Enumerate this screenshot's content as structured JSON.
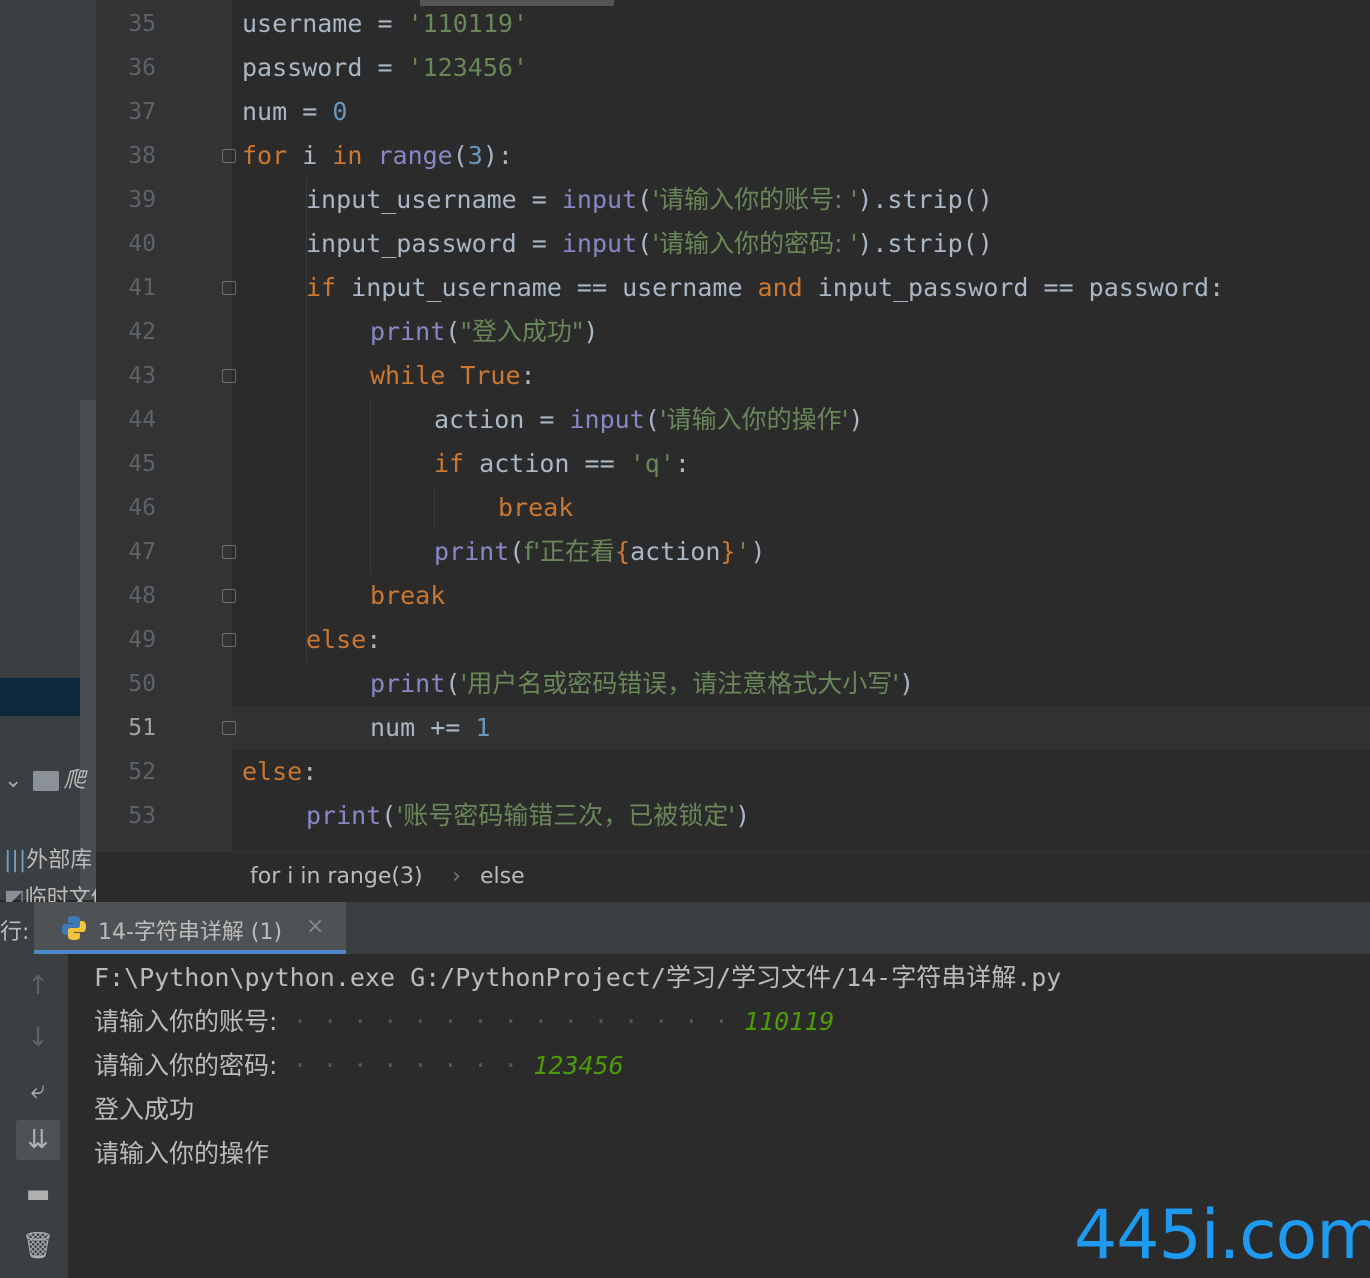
{
  "project_panel": {
    "items": [
      {
        "label": "爬",
        "icon": "folder-icon"
      },
      {
        "label": "外部库",
        "icon": "library-icon"
      },
      {
        "label": "临时文件",
        "icon": "scratch-icon"
      }
    ]
  },
  "editor": {
    "current_line": "51",
    "lines": [
      {
        "n": "35"
      },
      {
        "n": "36"
      },
      {
        "n": "37"
      },
      {
        "n": "38"
      },
      {
        "n": "39"
      },
      {
        "n": "40"
      },
      {
        "n": "41"
      },
      {
        "n": "42"
      },
      {
        "n": "43"
      },
      {
        "n": "44"
      },
      {
        "n": "45"
      },
      {
        "n": "46"
      },
      {
        "n": "47"
      },
      {
        "n": "48"
      },
      {
        "n": "49"
      },
      {
        "n": "50"
      },
      {
        "n": "51"
      },
      {
        "n": "52"
      },
      {
        "n": "53"
      }
    ],
    "code": {
      "l35": {
        "a": "username",
        "b": " = ",
        "c": "'110119'"
      },
      "l36": {
        "a": "password",
        "b": " = ",
        "c": "'123456'"
      },
      "l37": {
        "a": "num",
        "b": " = ",
        "c": "0"
      },
      "l38": {
        "kw": "for",
        "a": " i ",
        "kw2": "in",
        "fn": " range",
        "p1": "(",
        "n": "3",
        "p2": "):"
      },
      "l39": {
        "a": "input_username",
        "b": " = ",
        "fn": "input",
        "p1": "(",
        "s": "'请输入你的账号: '",
        "p2": ").strip()"
      },
      "l40": {
        "a": "input_password",
        "b": " = ",
        "fn": "input",
        "p1": "(",
        "s": "'请输入你的密码: '",
        "p2": ").strip()"
      },
      "l41": {
        "kw": "if",
        "a": " input_username == username ",
        "kw2": "and",
        "b": " input_password == password:"
      },
      "l42": {
        "fn": "print",
        "p1": "(",
        "s": "\"登入成功\"",
        "p2": ")"
      },
      "l43": {
        "kw": "while",
        "sp": " ",
        "kw2": "True",
        "p": ":"
      },
      "l44": {
        "a": "action",
        "b": " = ",
        "fn": "input",
        "p1": "(",
        "s": "'请输入你的操作'",
        "p2": ")"
      },
      "l45": {
        "kw": "if",
        "a": " action == ",
        "s": "'q'",
        "p": ":"
      },
      "l46": {
        "kw": "break"
      },
      "l47": {
        "fn": "print",
        "p1": "(",
        "s1": "f'正在看",
        "br1": "{",
        "v": "action",
        "br2": "}",
        "s2": "'",
        "p2": ")"
      },
      "l48": {
        "kw": "break"
      },
      "l49": {
        "kw": "else",
        "p": ":"
      },
      "l50": {
        "fn": "print",
        "p1": "(",
        "s": "'用户名或密码错误，请注意格式大小写'",
        "p2": ")"
      },
      "l51": {
        "a": "num += ",
        "n": "1"
      },
      "l52": {
        "kw": "else",
        "p": ":"
      },
      "l53": {
        "fn": "print",
        "p1": "(",
        "s": "'账号密码输错三次，已被锁定'",
        "p2": ")"
      }
    }
  },
  "breadcrumb": {
    "items": [
      "for i in range(3)",
      "else"
    ],
    "separator": "›"
  },
  "run_panel": {
    "label": "行:",
    "tab_title": "14-字符串详解 (1)",
    "close": "×",
    "console": {
      "command": "F:\\Python\\python.exe G:/PythonProject/学习/学习文件/14-字符串详解.py",
      "prompt_username": "请输入你的账号:",
      "input_username": "110119",
      "prompt_password": "请输入你的密码:",
      "input_password": "123456",
      "login_ok": "登入成功",
      "prompt_action": "请输入你的操作"
    },
    "tools": [
      "up-arrow-icon",
      "down-arrow-icon",
      "soft-wrap-icon",
      "scroll-to-end-icon",
      "print-icon",
      "trash-icon"
    ]
  },
  "watermark": "445i.com",
  "colors": {
    "keyword": "#cc7832",
    "builtin": "#8888c6",
    "string": "#6a8759",
    "number": "#6897bb",
    "text": "#a9b7c6",
    "user_input": "#4e9a06"
  }
}
